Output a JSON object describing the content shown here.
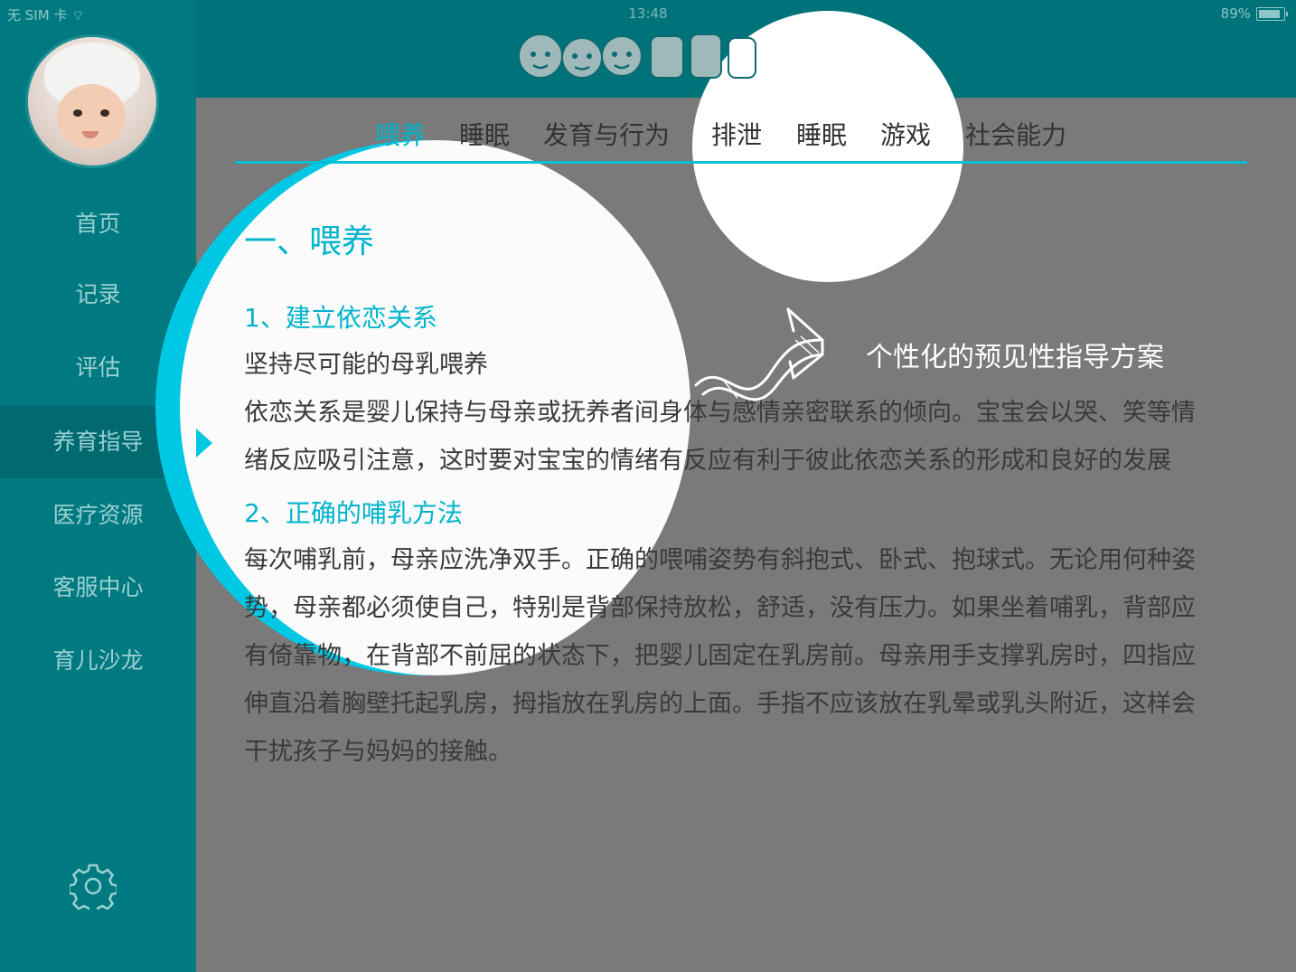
{
  "status_bar": {
    "carrier": "无 SIM 卡",
    "time": "13:48",
    "battery": "89%",
    "battery_level": 0.89
  },
  "sidebar": {
    "items": [
      {
        "label": "首页"
      },
      {
        "label": "记录"
      },
      {
        "label": "评估"
      },
      {
        "label": "养育指导"
      },
      {
        "label": "医疗资源"
      },
      {
        "label": "客服中心"
      },
      {
        "label": "育儿沙龙"
      }
    ],
    "active_index": 3,
    "settings_icon": "gear-icon"
  },
  "header": {
    "logo_icon": "baby-faces-logo"
  },
  "tabs": [
    "喂养",
    "睡眠",
    "发育与行为",
    "排泄",
    "睡眠",
    "游戏",
    "社会能力"
  ],
  "active_tab": 0,
  "article": {
    "title": "一、喂养",
    "section1_heading": "1、建立依恋关系",
    "section1_lines": [
      "坚持尽可能的母乳喂养",
      "依恋关系是婴儿保持与母亲或抚养者间身体与感情亲密联系的倾向。宝宝会以哭、笑等情",
      "绪反应吸引注意，这时要对宝宝的情绪有反应有利于彼此依恋关系的形成和良好的发展"
    ],
    "section2_heading": "2、正确的哺乳方法",
    "section2_lines": [
      "每次哺乳前，母亲应洗净双手。正确的喂哺姿势有斜抱式、卧式、抱球式。无论用何种姿",
      "势，母亲都必须使自己，特别是背部保持放松，舒适，没有压力。如果坐着哺乳，背部应",
      "有倚靠物，在背部不前屈的状态下，把婴儿固定在乳房前。母亲用手支撑乳房时，四指应",
      "伸直沿着胸壁托起乳房，拇指放在乳房的上面。手指不应该放在乳晕或乳头附近，这样会",
      "干扰孩子与妈妈的接触。"
    ]
  },
  "callout": {
    "text": "个性化的预见性指导方案",
    "icon": "curved-arrow-icon"
  },
  "colors": {
    "teal": "#007a80",
    "accent": "#00b4cc",
    "overlay": "#7a7a7a"
  }
}
